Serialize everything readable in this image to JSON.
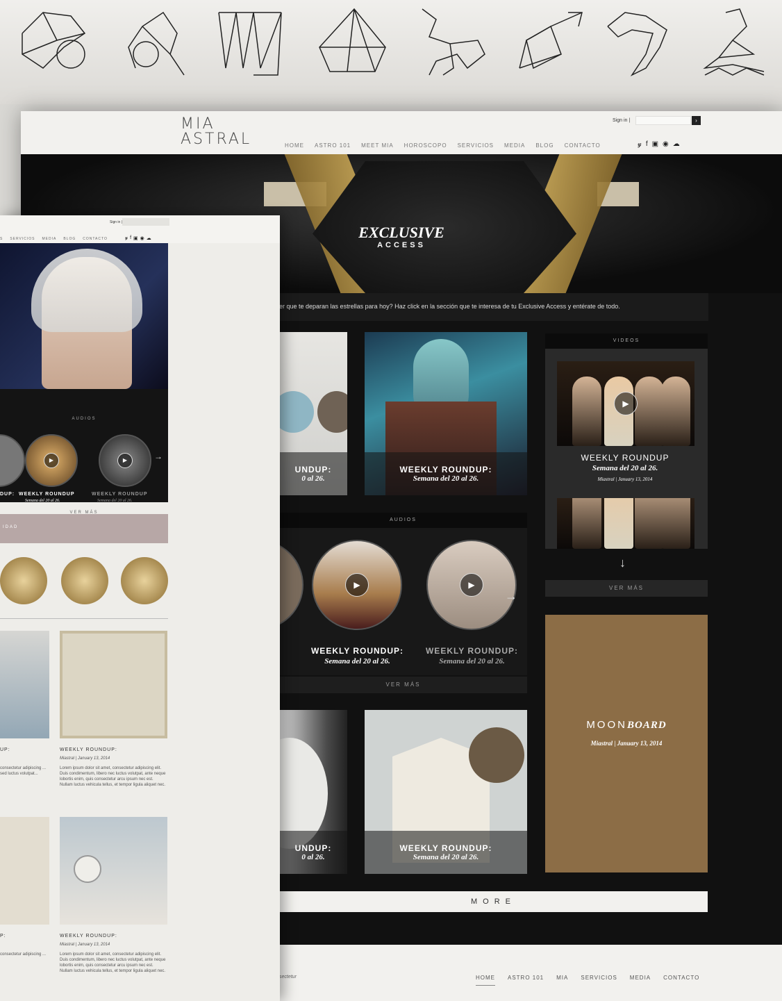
{
  "constellations": [
    "aries-constellation",
    "leo-constellation",
    "virgo-constellation",
    "libra-constellation",
    "scorpio-constellation",
    "sagittarius-constellation",
    "capricorn-constellation",
    "aquarius-constellation"
  ],
  "site": {
    "logo_line1": "MIA",
    "logo_line2": "ASTRAL",
    "signin_label": "Sign in |",
    "nav": [
      "HOME",
      "ASTRO 101",
      "MEET MIA",
      "HOROSCOPO",
      "SERVICIOS",
      "MEDIA",
      "BLOG",
      "CONTACTO"
    ],
    "social_icons": [
      "twitter-icon",
      "facebook-icon",
      "instagram-icon",
      "pinterest-icon",
      "soundcloud-icon"
    ]
  },
  "hero": {
    "title": "EXCLUSIVE",
    "subtitle": "ACCESS"
  },
  "intro_text": "er que te deparan las estrellas para hoy? Haz click en la sección que te interesa de tu Exclusive Access y entérate de todo.",
  "tiles": {
    "partial_caption": "UNDUP:",
    "partial_sub": "0 al 26.",
    "main_caption": "WEEKLY ROUNDUP:",
    "main_sub": "Semana del 20 al 26."
  },
  "audios": {
    "header": "AUDIOS",
    "partial": "UP:",
    "item1_title": "WEEKLY ROUNDUP:",
    "item1_sub": "Semana del 20 al 26.",
    "item2_title": "WEEKLY ROUNDUP:",
    "item2_sub": "Semana del 20 al 26.",
    "more": "VER MÁS"
  },
  "videos": {
    "header": "VIDEOS",
    "title": "WEEKLY ROUNDUP",
    "sub": "Semana del 20 al 26.",
    "meta": "Miastral | January 13, 2014",
    "more": "VER MÁS"
  },
  "moonboard": {
    "title_a": "MOON",
    "title_b": "BOARD",
    "meta": "Miastral | January 13, 2014"
  },
  "lower_tiles": {
    "partial_caption": "UNDUP:",
    "partial_sub": "0 al 26.",
    "main_caption": "WEEKLY ROUNDUP:",
    "main_sub": "Semana del 20 al 26."
  },
  "more_button": "MORE",
  "footer": {
    "nav": [
      "HOME",
      "ASTRO 101",
      "MIA",
      "SERVICIOS",
      "MEDIA",
      "CONTACTO"
    ],
    "text": "sectetur"
  },
  "light_page": {
    "signin_label": "Sign in |",
    "nav": [
      "S",
      "SERVICIOS",
      "MEDIA",
      "BLOG",
      "CONTACTO"
    ],
    "audios_header": "AUDIOS",
    "audio_titles": [
      "DUP:",
      "WEEKLY ROUNDUP",
      "WEEKLY ROUNDUP"
    ],
    "audio_subs": [
      "",
      "Semana del 20 al 26.",
      "Semana del 20 al 26."
    ],
    "ver_mas": "VER MÁS",
    "band_label": "IDAD",
    "cards": [
      {
        "title": "UP:",
        "text": "consectetur adipiscing ... sed luctus volutpat..."
      },
      {
        "title": "WEEKLY ROUNDUP:",
        "meta": "Miastral | January 13, 2014",
        "text": "Lorem ipsum dolor sit amet, consectetur adipiscing elit. Duis condimentum, libero nec luctus volutpat, ante neque lobortis enim, quis consectetur arcu ipsum nec est. Nullam luctus vehicula tellus, et tempor ligula aliquet nec."
      },
      {
        "title": "P:",
        "text": "consectetur adipiscing ..."
      },
      {
        "title": "WEEKLY ROUNDUP:",
        "meta": "Miastral | January 13, 2014",
        "text": "Lorem ipsum dolor sit amet, consectetur adipiscing elit. Duis condimentum, libero nec luctus volutpat, ante neque lobortis enim, quis consectetur arcu ipsum nec est. Nullam luctus vehicula tellus, et tempor ligula aliquet nec."
      }
    ]
  }
}
